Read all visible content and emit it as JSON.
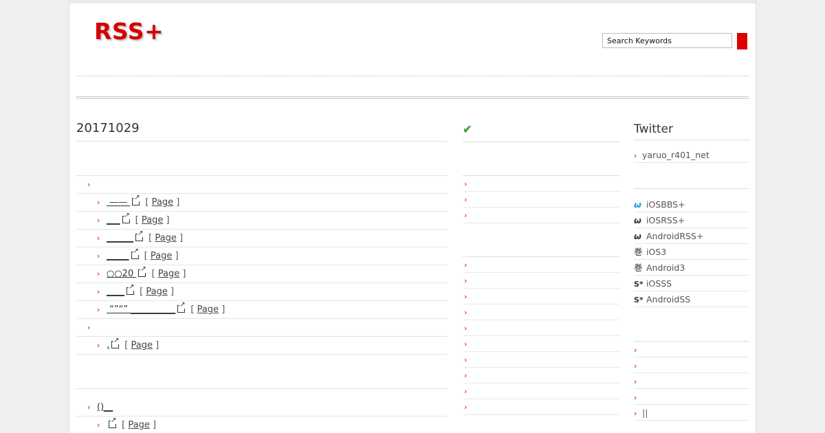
{
  "header": {
    "logo": "RSS+",
    "search_placeholder": "Search Keywords"
  },
  "main": {
    "title": "20171029",
    "groups": [
      {
        "items": [
          {
            "link": " ——  ",
            "page_label": "Page"
          },
          {
            "link": "___",
            "page_label": "Page"
          },
          {
            "link": "______",
            "page_label": "Page"
          },
          {
            "link": "_____",
            "page_label": "Page"
          },
          {
            "link": "○○20 ",
            "page_label": "Page"
          },
          {
            "link": "____",
            "page_label": "Page"
          },
          {
            "link": " “”“” __________",
            "page_label": "Page"
          }
        ]
      },
      {
        "items": [
          {
            "link": ",",
            "page_label": "Page"
          }
        ]
      }
    ],
    "bottom_category": "()__",
    "bottom_item": {
      "link": "",
      "page_label": "Page"
    }
  },
  "mid": {
    "check_icon": "check-icon"
  },
  "side": {
    "title": "Twitter",
    "twitter_account": "yaruo_r401_net",
    "apps": [
      {
        "icon": "ω",
        "label": "iOSBBS+",
        "color": "#1aa0d8"
      },
      {
        "icon": "ω",
        "label": "iOSRSS+",
        "color": "#333333"
      },
      {
        "icon": "ω",
        "label": "AndroidRSS+",
        "color": "#333333"
      },
      {
        "icon": "巻",
        "label": "iOS3",
        "color": "#333333"
      },
      {
        "icon": "巻",
        "label": "Android3",
        "color": "#333333"
      },
      {
        "icon": "S*",
        "label": "iOSSS",
        "color": "#333333"
      },
      {
        "icon": "S*",
        "label": "AndroidSS",
        "color": "#333333"
      }
    ],
    "last_link": "||"
  },
  "brand_color": "#d40000"
}
